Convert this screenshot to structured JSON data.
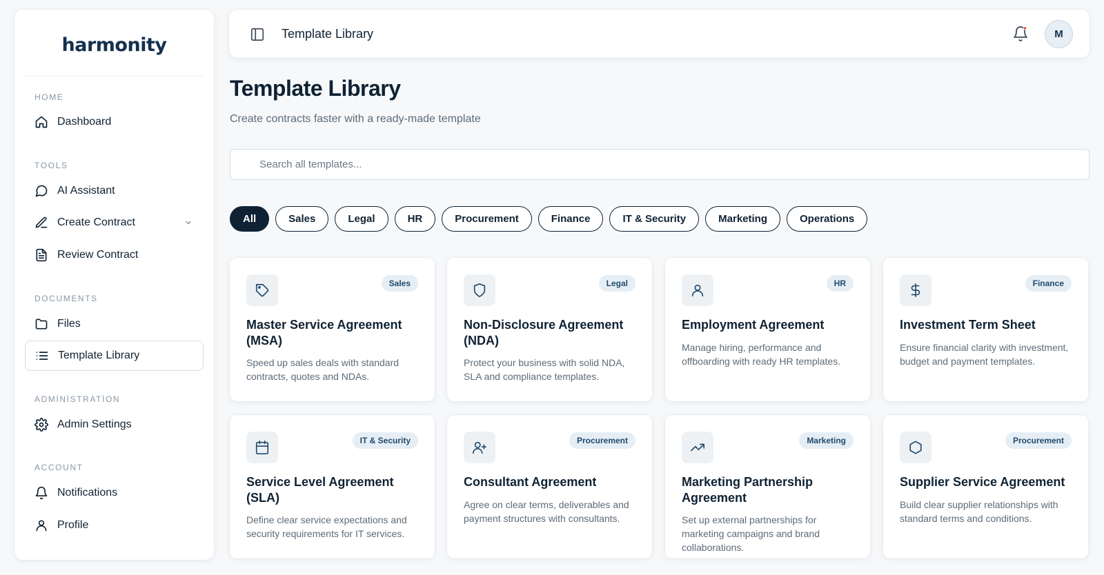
{
  "brand": {
    "logo": "harmonity"
  },
  "sidebar": {
    "sections": {
      "home": "HOME",
      "tools": "TOOLS",
      "documents": "DOCUMENTS",
      "administration": "ADMİNİSTRATİON",
      "account": "ACCOUNT"
    },
    "items": {
      "dashboard": "Dashboard",
      "ai_assistant": "AI Assistant",
      "create_contract": "Create Contract",
      "review_contract": "Review Contract",
      "files": "Files",
      "template_library": "Template Library",
      "admin_settings": "Admin Settings",
      "notifications": "Notifications",
      "profile": "Profile"
    },
    "active_item": "template_library"
  },
  "topbar": {
    "title": "Template Library",
    "avatar_initial": "M"
  },
  "main": {
    "title": "Template Library",
    "subtitle": "Create contracts faster with a ready-made template",
    "search_placeholder": "Search all templates...",
    "filters": [
      "All",
      "Sales",
      "Legal",
      "HR",
      "Procurement",
      "Finance",
      "IT & Security",
      "Marketing",
      "Operations"
    ],
    "active_filter": "All",
    "cards": [
      {
        "icon": "tag-icon",
        "badge": "Sales",
        "title": "Master Service Agreement (MSA)",
        "description": "Speed up sales deals with standard contracts, quotes and NDAs."
      },
      {
        "icon": "shield-icon",
        "badge": "Legal",
        "title": "Non-Disclosure Agreement (NDA)",
        "description": "Protect your business with solid NDA, SLA and compliance templates."
      },
      {
        "icon": "user-icon",
        "badge": "HR",
        "title": "Employment Agreement",
        "description": "Manage hiring, performance and offboarding with ready HR templates."
      },
      {
        "icon": "dollar-icon",
        "badge": "Finance",
        "title": "Investment Term Sheet",
        "description": "Ensure financial clarity with investment, budget and payment templates."
      },
      {
        "icon": "calendar-icon",
        "badge": "IT & Security",
        "title": "Service Level Agreement (SLA)",
        "description": "Define clear service expectations and security requirements for IT services."
      },
      {
        "icon": "user-plus-icon",
        "badge": "Procurement",
        "title": "Consultant Agreement",
        "description": "Agree on clear terms, deliverables and payment structures with consultants."
      },
      {
        "icon": "trending-up-icon",
        "badge": "Marketing",
        "title": "Marketing Partnership Agreement",
        "description": "Set up external partnerships for marketing campaigns and brand collaborations."
      },
      {
        "icon": "hexagon-icon",
        "badge": "Procurement",
        "title": "Supplier Service Agreement",
        "description": "Build clear supplier relationships with standard terms and conditions."
      }
    ]
  },
  "colors": {
    "primary": "#0f2233",
    "badge_bg": "#e6eef5",
    "badge_text": "#1f4a6e",
    "notification_dot": "#e0453a"
  }
}
